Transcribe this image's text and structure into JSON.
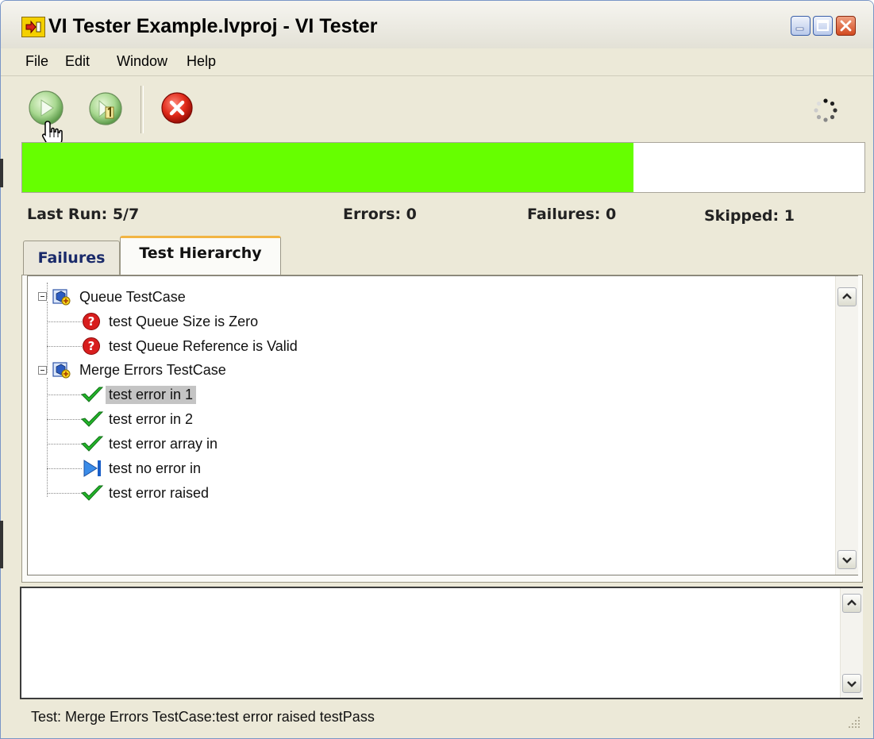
{
  "window": {
    "title": "VI Tester Example.lvproj - VI Tester",
    "controls": [
      "minimize-icon",
      "maximize-icon",
      "close-icon"
    ]
  },
  "menu": {
    "items": [
      "File",
      "Edit",
      "Window",
      "Help"
    ]
  },
  "toolbar": {
    "buttons": [
      "run-all-icon",
      "run-selected-icon",
      "abort-icon"
    ],
    "busy_indicator": "spinner-icon"
  },
  "progress": {
    "completed_fraction": 0.726,
    "fill_color": "#66ff00"
  },
  "stats": {
    "last_run": "Last Run:  5/7",
    "errors": "Errors: 0",
    "failures": "Failures: 0",
    "skipped": "Skipped: 1"
  },
  "tabs": [
    {
      "label": "Failures",
      "active": false
    },
    {
      "label": "Test Hierarchy",
      "active": true
    }
  ],
  "tree": {
    "groups": [
      {
        "label": "Queue TestCase",
        "icon": "testcase-icon",
        "tests": [
          {
            "label": "test Queue Size is Zero",
            "status": "error"
          },
          {
            "label": "test Queue Reference is Valid",
            "status": "error"
          }
        ]
      },
      {
        "label": "Merge Errors TestCase",
        "icon": "testcase-icon",
        "tests": [
          {
            "label": "test error in 1",
            "status": "pass",
            "selected": true
          },
          {
            "label": "test error in 2",
            "status": "pass"
          },
          {
            "label": "test error array in",
            "status": "pass"
          },
          {
            "label": "test no error in",
            "status": "skipped"
          },
          {
            "label": "test error raised",
            "status": "pass"
          }
        ]
      }
    ]
  },
  "status_bar": {
    "text": "Test: Merge Errors TestCase:test error raised testPass"
  },
  "colors": {
    "pass": "#22b52a",
    "error": "#d81e1e",
    "skipped": "#2e7de0",
    "selection": "#c4c4c4"
  }
}
